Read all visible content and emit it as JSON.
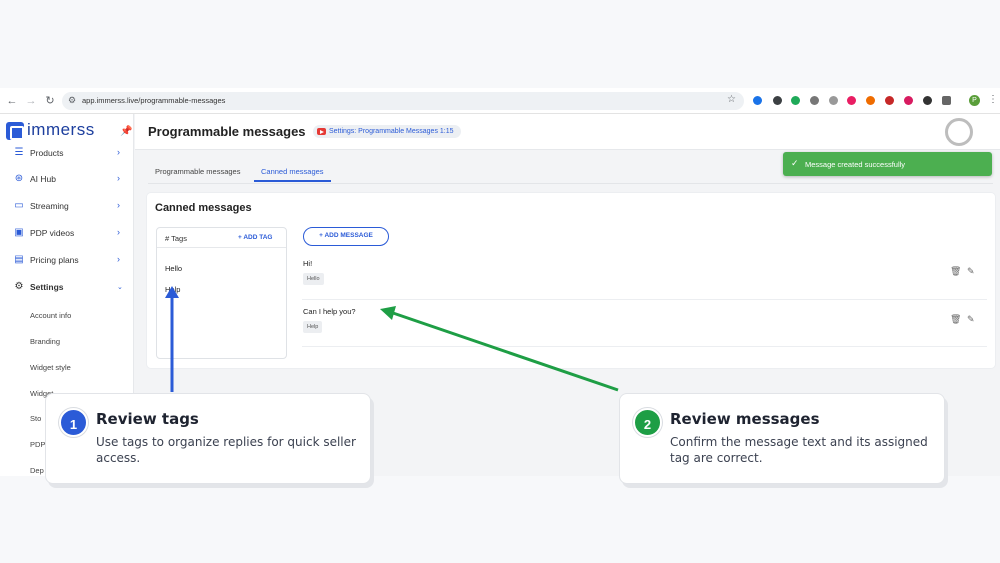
{
  "browser": {
    "url": "app.immerss.live/programmable-messages",
    "profile_initial": "P"
  },
  "sidebar": {
    "logo_text": "immerss",
    "items": [
      {
        "label": "Products",
        "icon": "list-icon"
      },
      {
        "label": "AI Hub",
        "icon": "ai-hub-icon"
      },
      {
        "label": "Streaming",
        "icon": "monitor-icon"
      },
      {
        "label": "PDP videos",
        "icon": "video-icon"
      },
      {
        "label": "Pricing plans",
        "icon": "pricing-icon"
      },
      {
        "label": "Settings",
        "icon": "gear-icon"
      }
    ],
    "sub_items": [
      "Account info",
      "Branding",
      "Widget style",
      "Widget",
      "Sto",
      "PDP",
      "Dep"
    ]
  },
  "header": {
    "title": "Programmable messages",
    "video_pill": "Settings: Programmable Messages 1:15"
  },
  "toast": {
    "text": "Message created successfully",
    "color": "#4caf50"
  },
  "tabs": [
    {
      "label": "Programmable messages",
      "active": false
    },
    {
      "label": "Canned messages",
      "active": true
    }
  ],
  "canned": {
    "title": "Canned messages",
    "tags_header": "# Tags",
    "add_tag": "+ ADD TAG",
    "tags": [
      "Hello",
      "Help"
    ],
    "add_message": "+ ADD MESSAGE",
    "messages": [
      {
        "text": "Hi!",
        "tag": "Hello"
      },
      {
        "text": "Can I help you?",
        "tag": "Help"
      }
    ]
  },
  "callouts": [
    {
      "number": "1",
      "title": "Review tags",
      "description": "Use tags to organize replies for quick seller access.",
      "color": "#2b5bd7"
    },
    {
      "number": "2",
      "title": "Review messages",
      "description": "Confirm the message text and its assigned tag are correct.",
      "color": "#1e9e45"
    }
  ],
  "colors": {
    "accent": "#2b5bd7",
    "success": "#4caf50"
  }
}
